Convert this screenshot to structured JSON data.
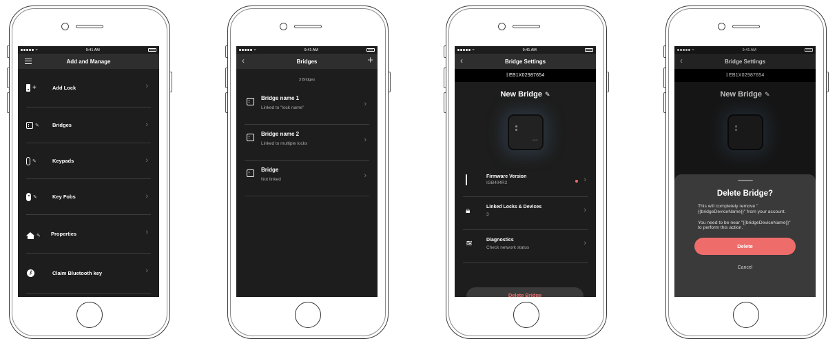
{
  "status": {
    "time": "9:41 AM"
  },
  "screen1": {
    "title": "Add and Manage",
    "items": [
      {
        "label": "Add Lock",
        "icon": "lock-plus-icon"
      },
      {
        "label": "Bridges",
        "icon": "bridge-edit-icon"
      },
      {
        "label": "Keypads",
        "icon": "keypad-edit-icon"
      },
      {
        "label": "Key Fobs",
        "icon": "keyfob-edit-icon"
      },
      {
        "label": "Properties",
        "icon": "home-edit-icon"
      },
      {
        "label": "Claim Bluetooth key",
        "icon": "bluetooth-icon"
      }
    ]
  },
  "screen2": {
    "title": "Bridges",
    "count": "3 Bridges",
    "bridges": [
      {
        "name": "Bridge name 1",
        "sub": "Linked to \"lock name\""
      },
      {
        "name": "Bridge name 2",
        "sub": "Linked to multiple locks"
      },
      {
        "name": "Bridge",
        "sub": "Not linked"
      }
    ]
  },
  "screen3": {
    "title": "Bridge Settings",
    "serial": "EB1X02987654",
    "bridge_name": "New Bridge",
    "device_brand": "august",
    "rows": [
      {
        "label": "Firmware Version",
        "value": "IGB404R2"
      },
      {
        "label": "Linked Locks & Devices",
        "value": "3"
      },
      {
        "label": "Diagnostics",
        "value": "Check network status"
      }
    ],
    "delete_label": "Delete Bridge"
  },
  "screen4": {
    "title": "Bridge Settings",
    "serial": "EB1X02987654",
    "bridge_name": "New Bridge",
    "sheet": {
      "heading": "Delete Bridge?",
      "para1": "This will completely remove \"{{bridgeDeviceName}}\" from your account.",
      "para2": "You need to be near \"{{bridgeDeviceName}}\" to perform this action.",
      "delete": "Delete",
      "cancel": "Cancel"
    }
  },
  "colors": {
    "accent": "#ee6d6a",
    "background": "#1d1d1d",
    "navbar": "#2e2e2e"
  }
}
